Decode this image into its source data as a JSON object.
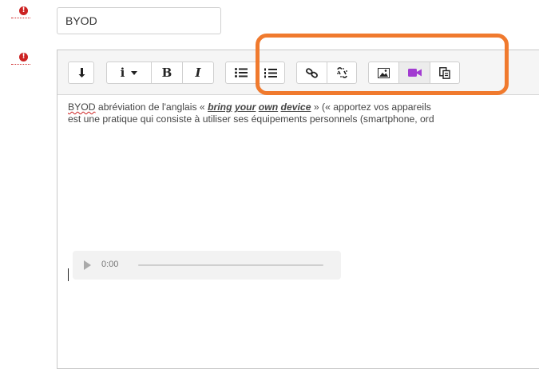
{
  "title_field": {
    "value": "BYOD"
  },
  "toolbar": {
    "bold_label": "B",
    "italic_label": "I"
  },
  "content": {
    "line1_a": "BYOD",
    "line1_b": " abréviation de l'anglais « ",
    "line1_bold_1": "bring",
    "line1_bold_2": "your",
    "line1_bold_3": "own",
    "line1_bold_4": "device",
    "line1_c": " » (« apportez vos appareils",
    "line2": "est une pratique qui consiste à utiliser ses équipements personnels (smartphone, ord"
  },
  "audio": {
    "time": "0:00"
  },
  "icons": {
    "error": "error-icon",
    "insert_break": "insert-break-icon",
    "info": "info-icon",
    "bullet_list": "bullet-list-icon",
    "numbered_list": "numbered-list-icon",
    "link": "link-icon",
    "unlink": "unlink-icon",
    "image": "image-icon",
    "video": "video-icon",
    "paste": "paste-icon"
  },
  "colors": {
    "highlight": "#f07a2e",
    "video_icon": "#a23bd1",
    "error": "#cc2222"
  }
}
